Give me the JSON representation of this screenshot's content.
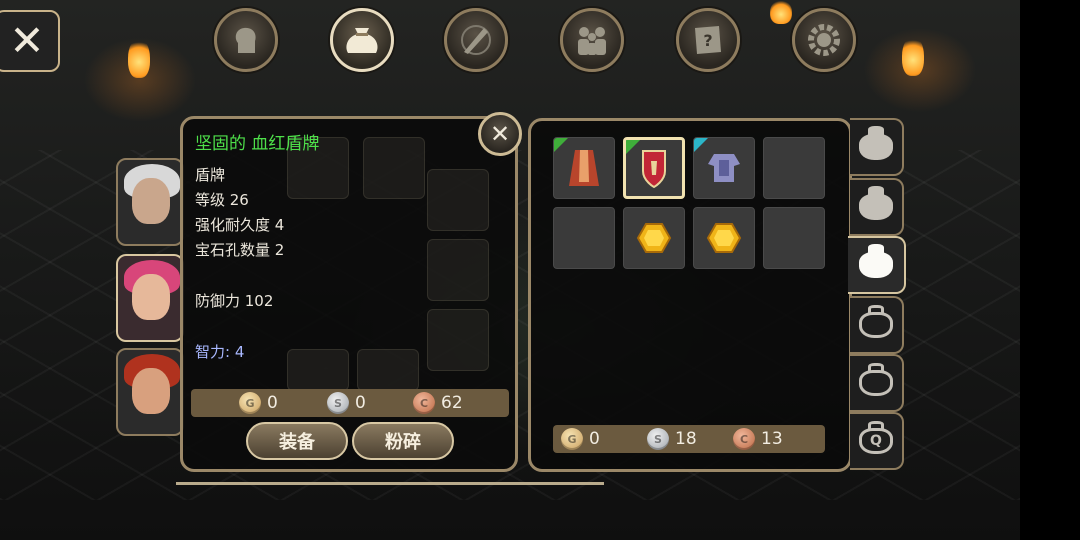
{
  "top_tabs": [
    {
      "name": "character",
      "icon": "head-icon",
      "active": false
    },
    {
      "name": "inventory",
      "icon": "bag-icon",
      "active": true
    },
    {
      "name": "skills",
      "icon": "sword-icon",
      "active": false
    },
    {
      "name": "party",
      "icon": "party-icon",
      "active": false
    },
    {
      "name": "quests",
      "icon": "scroll-icon",
      "active": false
    },
    {
      "name": "settings",
      "icon": "gear-icon",
      "active": false
    }
  ],
  "item": {
    "name": "坚固的 血红盾牌",
    "type": "盾牌",
    "level": "等级 26",
    "enhance": "强化耐久度 4",
    "gem_slots": "宝石孔数量 2",
    "defense": "防御力 102",
    "bonus": "智力: 4",
    "price": {
      "gold": "0",
      "silver": "0",
      "copper": "62"
    },
    "buttons": {
      "equip": "装备",
      "smash": "粉碎"
    }
  },
  "inventory": {
    "money": {
      "gold": "0",
      "silver": "18",
      "copper": "13"
    },
    "slots": [
      {
        "item": "red-cloak-icon",
        "rarity": "#3fae3a"
      },
      {
        "item": "red-shield-icon",
        "rarity": "#3fae3a",
        "selected": true
      },
      {
        "item": "steel-armor-icon",
        "rarity": "#2bb6c9"
      },
      {
        "item": null
      },
      {
        "item": null
      },
      {
        "item": "yellow-gem-icon"
      },
      {
        "item": "yellow-gem-icon"
      },
      {
        "item": null
      }
    ]
  },
  "bag_tabs": [
    "bag-1",
    "bag-2",
    "bag-3",
    "bag-4",
    "bag-5",
    "bag-quest"
  ],
  "bag_quest_label": "Q",
  "colors": {
    "item_name": "#4ee04a",
    "stat_bonus": "#a9b8ff",
    "frame": "#9b8868"
  }
}
